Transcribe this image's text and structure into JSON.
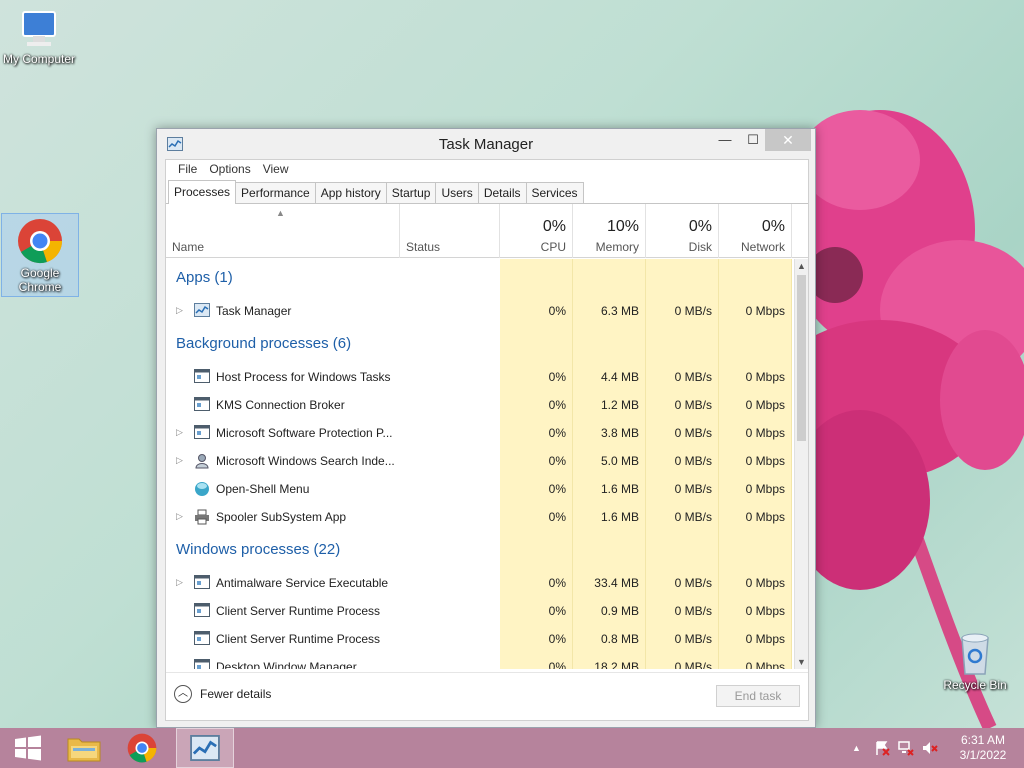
{
  "desktop": {
    "icons": [
      {
        "label": "My Computer"
      },
      {
        "label": "Google Chrome"
      },
      {
        "label": "Recycle Bin"
      }
    ]
  },
  "window": {
    "title": "Task Manager",
    "minimize": "—",
    "maximize": "☐",
    "close": "✕",
    "menu": [
      "File",
      "Options",
      "View"
    ],
    "tabs": [
      "Processes",
      "Performance",
      "App history",
      "Startup",
      "Users",
      "Details",
      "Services"
    ],
    "active_tab": "Processes",
    "columns": {
      "name": "Name",
      "status": "Status",
      "cpu": {
        "pct": "0%",
        "label": "CPU"
      },
      "memory": {
        "pct": "10%",
        "label": "Memory"
      },
      "disk": {
        "pct": "0%",
        "label": "Disk"
      },
      "network": {
        "pct": "0%",
        "label": "Network"
      }
    },
    "groups": [
      {
        "title": "Apps (1)",
        "processes": [
          {
            "name": "Task Manager",
            "cpu": "0%",
            "memory": "6.3 MB",
            "disk": "0 MB/s",
            "network": "0 Mbps",
            "expandable": true,
            "icon": "task-manager-icon"
          }
        ]
      },
      {
        "title": "Background processes (6)",
        "processes": [
          {
            "name": "Host Process for Windows Tasks",
            "cpu": "0%",
            "memory": "4.4 MB",
            "disk": "0 MB/s",
            "network": "0 Mbps",
            "expandable": false,
            "icon": "process-window-icon"
          },
          {
            "name": "KMS Connection Broker",
            "cpu": "0%",
            "memory": "1.2 MB",
            "disk": "0 MB/s",
            "network": "0 Mbps",
            "expandable": false,
            "icon": "process-window-icon"
          },
          {
            "name": "Microsoft Software Protection P...",
            "cpu": "0%",
            "memory": "3.8 MB",
            "disk": "0 MB/s",
            "network": "0 Mbps",
            "expandable": true,
            "icon": "process-window-icon"
          },
          {
            "name": "Microsoft Windows Search Inde...",
            "cpu": "0%",
            "memory": "5.0 MB",
            "disk": "0 MB/s",
            "network": "0 Mbps",
            "expandable": true,
            "icon": "search-person-icon"
          },
          {
            "name": "Open-Shell Menu",
            "cpu": "0%",
            "memory": "1.6 MB",
            "disk": "0 MB/s",
            "network": "0 Mbps",
            "expandable": false,
            "icon": "shell-orb-icon"
          },
          {
            "name": "Spooler SubSystem App",
            "cpu": "0%",
            "memory": "1.6 MB",
            "disk": "0 MB/s",
            "network": "0 Mbps",
            "expandable": true,
            "icon": "printer-icon"
          }
        ]
      },
      {
        "title": "Windows processes (22)",
        "processes": [
          {
            "name": "Antimalware Service Executable",
            "cpu": "0%",
            "memory": "33.4 MB",
            "disk": "0 MB/s",
            "network": "0 Mbps",
            "expandable": true,
            "icon": "process-window-icon"
          },
          {
            "name": "Client Server Runtime Process",
            "cpu": "0%",
            "memory": "0.9 MB",
            "disk": "0 MB/s",
            "network": "0 Mbps",
            "expandable": false,
            "icon": "process-window-icon"
          },
          {
            "name": "Client Server Runtime Process",
            "cpu": "0%",
            "memory": "0.8 MB",
            "disk": "0 MB/s",
            "network": "0 Mbps",
            "expandable": false,
            "icon": "process-window-icon"
          },
          {
            "name": "Desktop Window Manager",
            "cpu": "0%",
            "memory": "18.2 MB",
            "disk": "0 MB/s",
            "network": "0 Mbps",
            "expandable": false,
            "icon": "process-window-icon"
          }
        ]
      }
    ],
    "footer": {
      "fewer_details": "Fewer details",
      "end_task": "End task"
    }
  },
  "taskbar": {
    "clock_time": "6:31 AM",
    "clock_date": "3/1/2022",
    "tray_up": "▲"
  },
  "colors": {
    "taskbar": "#b6839c",
    "group_title": "#1e5fa8",
    "heat": "#fff4c4"
  }
}
